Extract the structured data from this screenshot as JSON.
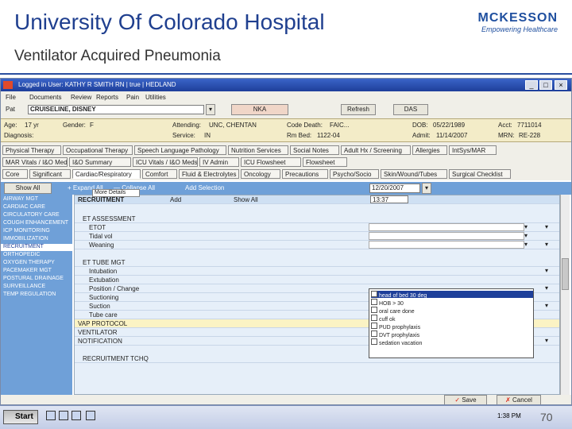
{
  "slide": {
    "title": "University Of Colorado Hospital",
    "subtitle": "Ventilator Acquired Pneumonia",
    "logo": {
      "brand": "MCKESSON",
      "tagline": "Empowering Healthcare"
    },
    "page_number": "70"
  },
  "app": {
    "window_title": "Logged in User: KATHY R SMITH RN | true | HEDLAND",
    "menus": [
      "File",
      "Documents",
      "Review",
      "Reports",
      "Pain",
      "Utilities"
    ],
    "patient_toolbar": {
      "patient_label": "Pat",
      "patient_name": "CRUISELINE, DISNEY",
      "allergy": "NKA",
      "refresh": "Refresh",
      "das": "DAS"
    },
    "patient_info": [
      {
        "label": "Age:",
        "value": "17 yr"
      },
      {
        "label": "Gender:",
        "value": "F"
      },
      {
        "label": "Attending:",
        "value": "UNC, CHENTAN"
      },
      {
        "label": "Code Death:",
        "value": "FAIC..."
      },
      {
        "label": "DOB:",
        "value": "05/22/1989"
      },
      {
        "label": "Acct:",
        "value": "7711014"
      },
      {
        "label": "Diagnosis:",
        "value": ""
      },
      {
        "label": "Service:",
        "value": "IN"
      },
      {
        "label": "Rm Bed:",
        "value": "1122-04"
      },
      {
        "label": "Admit:",
        "value": "11/14/2007"
      },
      {
        "label": "MRN:",
        "value": "RE-228"
      }
    ],
    "tab_row1": [
      "Physical Therapy",
      "Occupational Therapy",
      "Speech Language Pathology",
      "Nutrition Services",
      "Social Notes",
      "Adult Hx / Screening",
      "Allergies",
      "IntSys/MAR"
    ],
    "tab_row2": [
      "MAR Vitals / I&O Meds",
      "I&O Summary",
      "ICU Vitals / I&O Meds",
      "IV Admin",
      "ICU Flowsheet",
      "Flowsheet"
    ],
    "tab_row3": [
      "Core",
      "Significant",
      "Cardiac/Respiratory",
      "Comfort",
      "Fluid & Electrolytes",
      "Oncology",
      "Precautions",
      "Psycho/Socio",
      "Skin/Wound/Tubes",
      "Surgical Checklist"
    ],
    "work_toolbar": {
      "show_all": "Show All",
      "expand_all": "+ Expand All",
      "collapse_all": "— Collapse All",
      "add_selection": "Add Selection",
      "date": "12/20/2007",
      "time": "13:37"
    },
    "left_list": [
      "AIRWAY MGT",
      "CARDIAC CARE",
      "CIRCULATORY CARE",
      "COUGH ENHANCEMENT",
      "ICP MONITORING",
      "IMMOBILIZATION",
      "RECRUITMENT",
      "ORTHOPEDIC",
      "OXYGEN THERAPY",
      "PACEMAKER MGT",
      "POSTURAL DRAINAGE",
      "SURVEILLANCE",
      "TEMP REGULATION"
    ],
    "left_list_selected": 6,
    "grid_header": {
      "item": "RECRUITMENT",
      "more": "More Details",
      "add": "Add",
      "show_all": "Show All"
    },
    "grid_rows": [
      "ET ASSESSMENT",
      "ETOT",
      "Tidal vol",
      "Weaning",
      "",
      "ET TUBE MGT",
      "Intubation",
      "Extubation",
      "Position / Change",
      "Suctioning",
      "Suction",
      "Tube care",
      "VAP PROTOCOL",
      "VENTILATOR",
      "NOTIFICATION",
      "",
      "RECRUITMENT TCHQ"
    ],
    "check_items": [
      "head of bed 30 deg",
      "HOB > 30",
      "oral care done",
      "cuff ok",
      "PUD prophylaxis",
      "DVT prophylaxis",
      "sedation vacation"
    ],
    "check_selected": 0,
    "buttons": {
      "save": "Save",
      "cancel": "Cancel"
    }
  },
  "taskbar": {
    "start": "Start",
    "clock": "1:38 PM"
  },
  "colors": {
    "title": "#1f3f8f",
    "accent": "#6fa0d8",
    "selection": "#1e3f9a",
    "patient_bar": "#f3ecc8"
  }
}
